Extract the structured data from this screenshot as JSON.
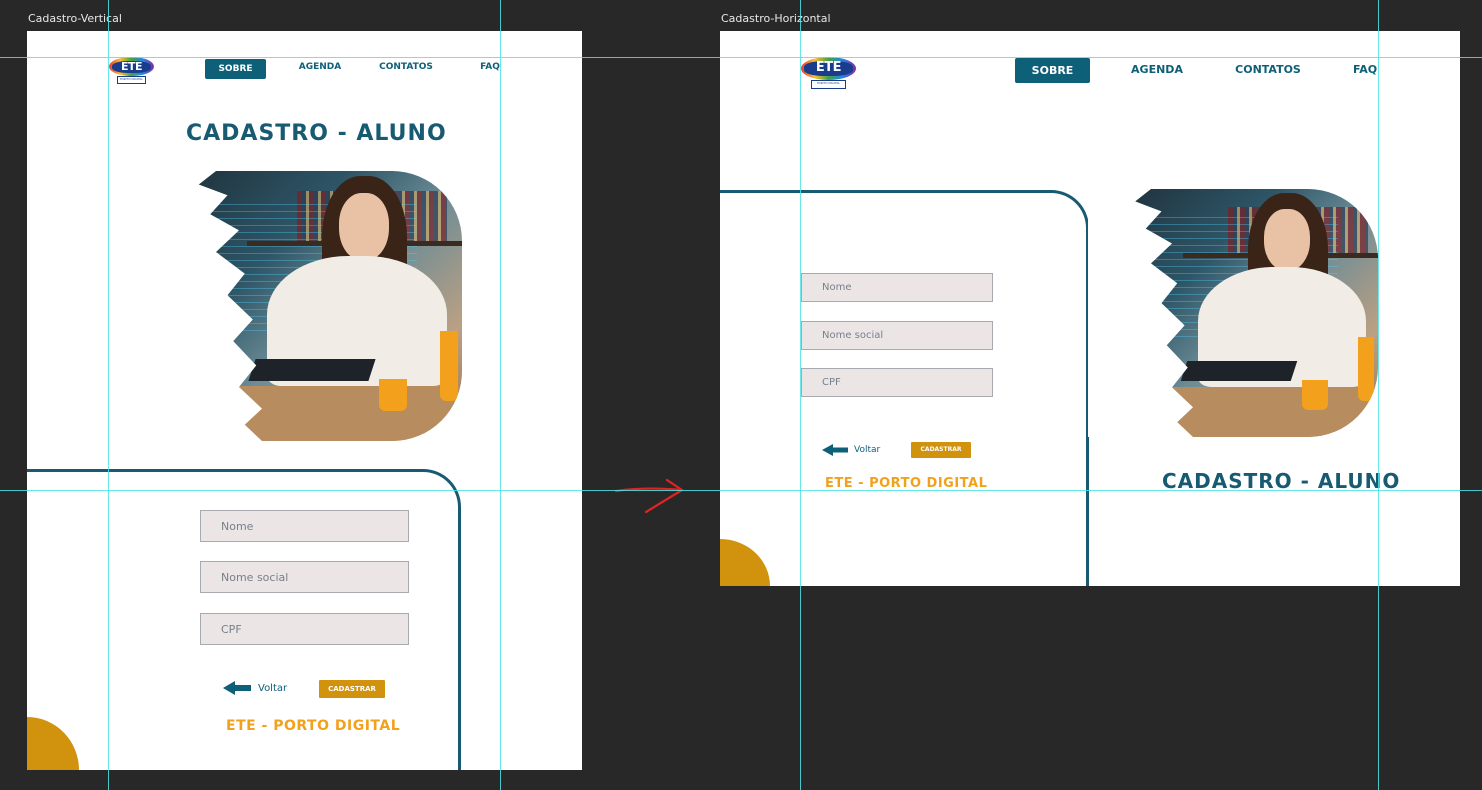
{
  "frames": {
    "vertical": {
      "label": "Cadastro-Vertical",
      "nav": {
        "active": "SOBRE",
        "agenda": "AGENDA",
        "contatos": "CONTATOS",
        "faq": "FAQ"
      },
      "logo": {
        "text": "ETE",
        "sub": "PORTO DIGITAL"
      },
      "title": "CADASTRO - ALUNO",
      "form": {
        "nome_placeholder": "Nome",
        "nome_social_placeholder": "Nome social",
        "cpf_placeholder": "CPF",
        "back_label": "Voltar",
        "submit_label": "CADASTRAR"
      },
      "brand": "ETE - PORTO DIGITAL"
    },
    "horizontal": {
      "label": "Cadastro-Horizontal",
      "nav": {
        "active": "SOBRE",
        "agenda": "AGENDA",
        "contatos": "CONTATOS",
        "faq": "FAQ"
      },
      "logo": {
        "text": "ETE",
        "sub": "PORTO DIGITAL"
      },
      "title": "CADASTRO - ALUNO",
      "form": {
        "nome_placeholder": "Nome",
        "nome_social_placeholder": "Nome social",
        "cpf_placeholder": "CPF",
        "back_label": "Voltar",
        "submit_label": "CADASTRAR"
      },
      "brand": "ETE - PORTO DIGITAL"
    }
  },
  "colors": {
    "teal": "#0e5f78",
    "title_teal": "#175a72",
    "gold": "#d1920e",
    "orange_text": "#f2a11d",
    "field_bg": "#ece5e6",
    "canvas_bg": "#282828",
    "guide": "#4fe4e8",
    "annotation_arrow": "#e02424"
  },
  "icons": [
    "back-arrow-icon",
    "ete-logo",
    "annotation-arrow-icon"
  ]
}
